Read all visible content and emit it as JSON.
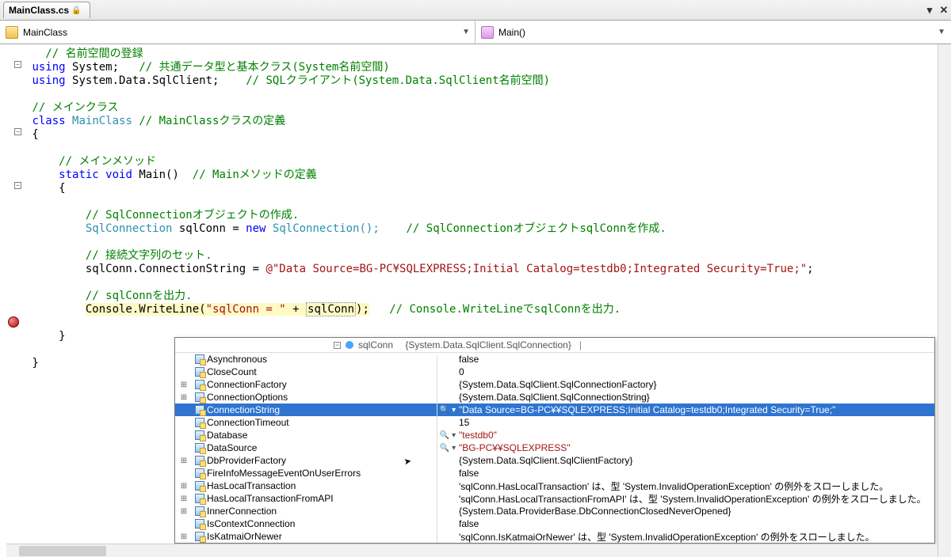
{
  "tab": {
    "filename": "MainClass.cs",
    "locked": true
  },
  "nav": {
    "class_label": "MainClass",
    "method_label": "Main()"
  },
  "code": {
    "c_ns": "// 名前空間の登録",
    "u1a": "using",
    "u1b": "System;",
    "u1c": "// 共通データ型と基本クラス(System名前空間)",
    "u2a": "using",
    "u2b": "System.Data.SqlClient;",
    "u2c": "// SQLクライアント(System.Data.SqlClient名前空間)",
    "c_mc": "// メインクラス",
    "cls_kw": "class",
    "cls_name": "MainClass",
    "cls_cm": "// MainClassクラスの定義",
    "c_mm": "// メインメソッド",
    "m_static": "static",
    "m_void": "void",
    "m_name": "Main()",
    "m_cm": "// Mainメソッドの定義",
    "c_obj": "// SqlConnectionオブジェクトの作成.",
    "ty_sqlconn": "SqlConnection",
    "var_sqlconn": "sqlConn = ",
    "kw_new": "new",
    "ctor": "SqlConnection();",
    "c_obj2": "// SqlConnectionオブジェクトsqlConnを作成.",
    "c_conn": "// 接続文字列のセット.",
    "asn": "sqlConn.ConnectionString = ",
    "str_at": "@",
    "str_v": "\"Data Source=BG-PC¥SQLEXPRESS;Initial Catalog=testdb0;Integrated Security=True;\"",
    "semi": ";",
    "c_out": "// sqlConnを出力.",
    "cw": "Console.WriteLine(",
    "cw_s": "\"sqlConn = \"",
    "cw_plus": " + ",
    "cw_var": "sqlConn",
    "cw_end": ");",
    "cw_cm": "// Console.WriteLineでsqlConnを出力."
  },
  "debug": {
    "head_var": "sqlConn",
    "head_type": "{System.Data.SqlClient.SqlConnection}",
    "rows": [
      {
        "exp": "",
        "name": "Asynchronous",
        "vicon": "",
        "val": "false",
        "str": false
      },
      {
        "exp": "",
        "name": "CloseCount",
        "vicon": "",
        "val": "0",
        "str": false
      },
      {
        "exp": "+",
        "name": "ConnectionFactory",
        "vicon": "",
        "val": "{System.Data.SqlClient.SqlConnectionFactory}",
        "str": false
      },
      {
        "exp": "+",
        "name": "ConnectionOptions",
        "vicon": "",
        "val": "{System.Data.SqlClient.SqlConnectionString}",
        "str": false
      },
      {
        "exp": "",
        "name": "ConnectionString",
        "vicon": "🔍 ▾",
        "val": "\"Data Source=BG-PC¥¥SQLEXPRESS;Initial Catalog=testdb0;Integrated Security=True;\"",
        "str": true,
        "sel": true
      },
      {
        "exp": "",
        "name": "ConnectionTimeout",
        "vicon": "",
        "val": "15",
        "str": false
      },
      {
        "exp": "",
        "name": "Database",
        "vicon": "🔍 ▾",
        "val": "\"testdb0\"",
        "str": true
      },
      {
        "exp": "",
        "name": "DataSource",
        "vicon": "🔍 ▾",
        "val": "\"BG-PC¥¥SQLEXPRESS\"",
        "str": true
      },
      {
        "exp": "+",
        "name": "DbProviderFactory",
        "vicon": "",
        "val": "{System.Data.SqlClient.SqlClientFactory}",
        "str": false
      },
      {
        "exp": "",
        "name": "FireInfoMessageEventOnUserErrors",
        "vicon": "",
        "val": "false",
        "str": false
      },
      {
        "exp": "+",
        "name": "HasLocalTransaction",
        "vicon": "",
        "val": "'sqlConn.HasLocalTransaction' は、型 'System.InvalidOperationException' の例外をスローしました。",
        "str": false
      },
      {
        "exp": "+",
        "name": "HasLocalTransactionFromAPI",
        "vicon": "",
        "val": "'sqlConn.HasLocalTransactionFromAPI' は、型 'System.InvalidOperationException' の例外をスローしました。",
        "str": false
      },
      {
        "exp": "+",
        "name": "InnerConnection",
        "vicon": "",
        "val": "{System.Data.ProviderBase.DbConnectionClosedNeverOpened}",
        "str": false
      },
      {
        "exp": "",
        "name": "IsContextConnection",
        "vicon": "",
        "val": "false",
        "str": false
      },
      {
        "exp": "+",
        "name": "IsKatmaiOrNewer",
        "vicon": "",
        "val": "'sqlConn.IsKatmaiOrNewer' は、型 'System.InvalidOperationException' の例外をスローしました。",
        "str": false
      }
    ]
  }
}
